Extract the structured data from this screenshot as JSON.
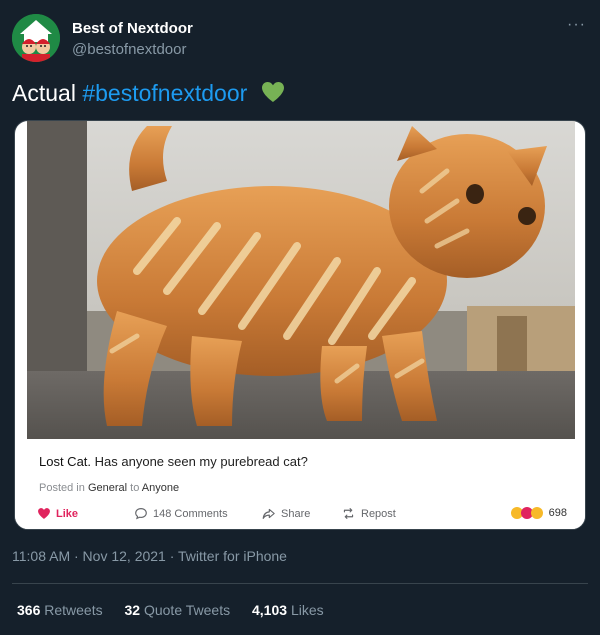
{
  "account": {
    "display_name": "Best of Nextdoor",
    "handle": "@bestofnextdoor",
    "more_label": "···"
  },
  "tweet": {
    "text_prefix": "Actual",
    "hashtag": "#bestofnextdoor",
    "emoji": "green-heart-icon"
  },
  "card": {
    "image_alt": "Loaf of bread shaped like a cat",
    "post_title_bold": "Lost Cat.",
    "post_title_rest": " Has anyone seen my purebread cat?",
    "meta_posted_in": "Posted in",
    "meta_category": "General",
    "meta_to": "to",
    "meta_audience": "Anyone",
    "like_label": "Like",
    "comments_label": "148 Comments",
    "share_label": "Share",
    "repost_label": "Repost",
    "reaction_count": "698"
  },
  "meta": {
    "timestamp": "11:08 AM · Nov 12, 2021 · Twitter for iPhone"
  },
  "stats": {
    "retweets_count": "366",
    "retweets_label": "Retweets",
    "quotes_count": "32",
    "quotes_label": "Quote Tweets",
    "likes_count": "4,103",
    "likes_label": "Likes"
  },
  "colors": {
    "background": "#15202b",
    "hashtag": "#1d9bf0",
    "secondary_text": "#8899a6",
    "heart_green": "#77b255"
  }
}
